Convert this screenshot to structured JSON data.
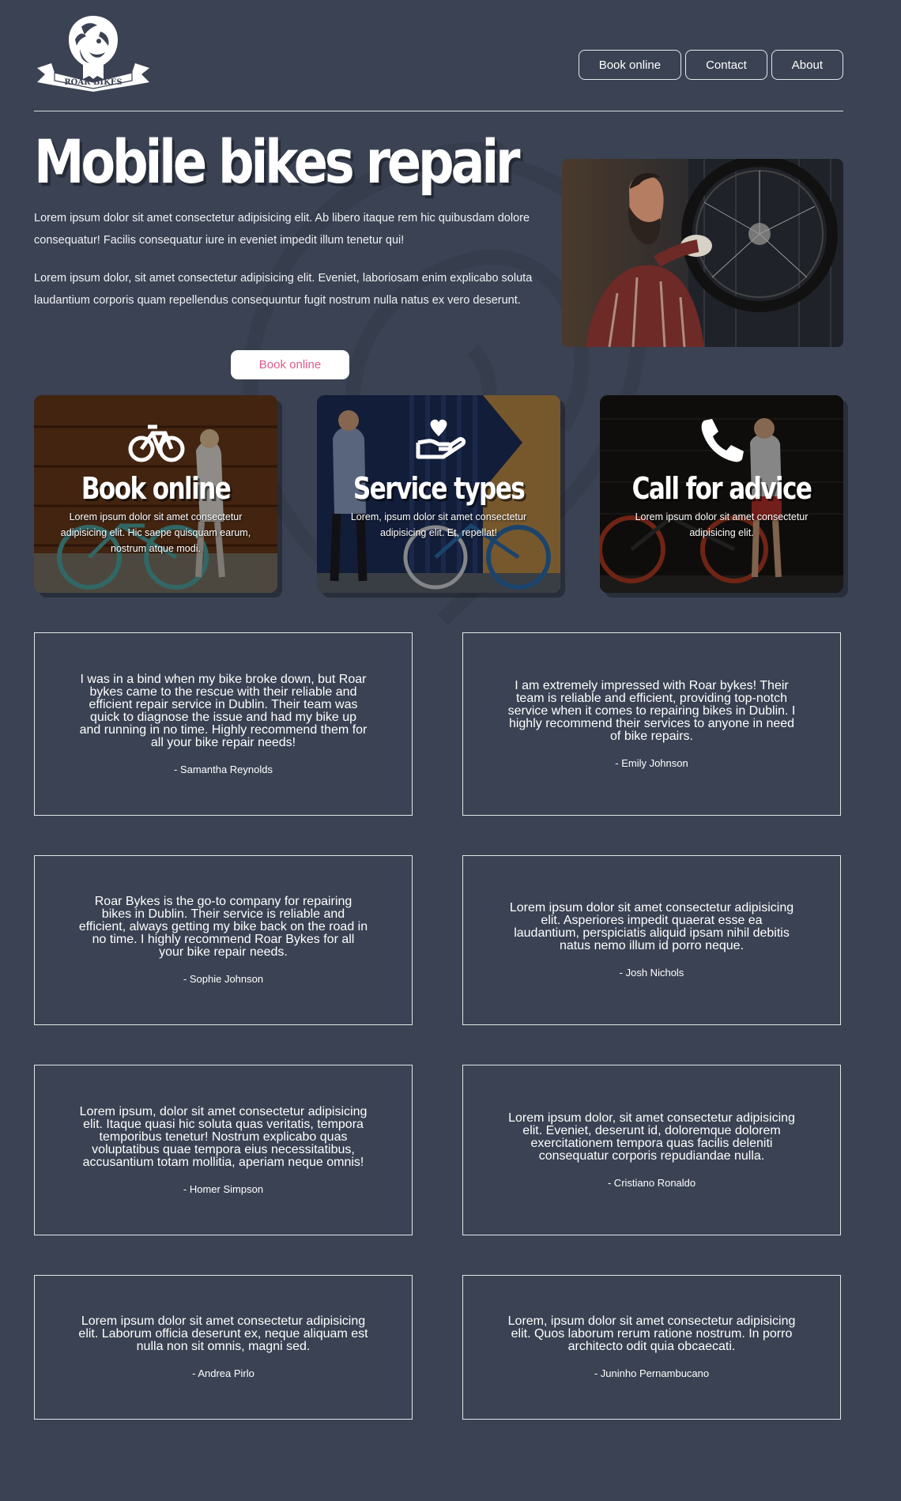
{
  "brand": {
    "logo_text": "ROAR BIKES"
  },
  "nav": [
    "Book online",
    "Contact",
    "About"
  ],
  "hero": {
    "title": "Mobile bikes repair",
    "p1": "Lorem ipsum dolor sit amet consectetur adipisicing elit. Ab libero itaque rem hic quibusdam dolore consequatur! Facilis consequatur iure in eveniet impedit illum tenetur qui!",
    "p2": "Lorem ipsum dolor, sit amet consectetur adipisicing elit. Eveniet, laboriosam enim explicabo soluta laudantium corporis quam repellendus consequuntur fugit nostrum nulla natus ex vero deserunt.",
    "cta": "Book online",
    "cta_color": "#e05a88"
  },
  "cards": [
    {
      "title": "Book online",
      "desc": "Lorem ipsum dolor sit amet consectetur adipisicing elit. Hic saepe quisquam earum, nostrum atque modi.",
      "icon": "bicycle-icon"
    },
    {
      "title": "Service types",
      "desc": "Lorem, ipsum dolor sit amet consectetur adipisicing elit. Et, repellat!",
      "icon": "hand-heart-icon"
    },
    {
      "title": "Call for advice",
      "desc": "Lorem ipsum dolor sit amet consectetur adipisicing elit.",
      "icon": "phone-icon"
    }
  ],
  "testimonials": [
    {
      "quote": "I was in a bind when my bike broke down, but Roar bykes came to the rescue with their reliable and efficient repair service in Dublin. Their team was quick to diagnose the issue and had my bike up and running in no time. Highly recommend them for all your bike repair needs!",
      "author": "- Samantha Reynolds"
    },
    {
      "quote": "I am extremely impressed with Roar bykes! Their team is reliable and efficient, providing top-notch service when it comes to repairing bikes in Dublin. I highly recommend their services to anyone in need of bike repairs.",
      "author": "- Emily Johnson"
    },
    {
      "quote": "Roar Bykes is the go-to company for repairing bikes in Dublin. Their service is reliable and efficient, always getting my bike back on the road in no time. I highly recommend Roar Bykes for all your bike repair needs.",
      "author": "- Sophie Johnson"
    },
    {
      "quote": "Lorem ipsum dolor sit amet consectetur adipisicing elit. Asperiores impedit quaerat esse ea laudantium, perspiciatis aliquid ipsam nihil debitis natus nemo illum id porro neque.",
      "author": "- Josh Nichols"
    },
    {
      "quote": "Lorem ipsum, dolor sit amet consectetur adipisicing elit. Itaque quasi hic soluta quas veritatis, tempora temporibus tenetur! Nostrum explicabo quas voluptatibus quae tempora eius necessitatibus, accusantium totam mollitia, aperiam neque omnis!",
      "author": "- Homer Simpson"
    },
    {
      "quote": "Lorem ipsum dolor, sit amet consectetur adipisicing elit. Eveniet, deserunt id, doloremque dolorem exercitationem tempora quas facilis deleniti consequatur corporis repudiandae nulla.",
      "author": "- Cristiano Ronaldo"
    },
    {
      "quote": "Lorem ipsum dolor sit amet consectetur adipisicing elit. Laborum officia deserunt ex, neque aliquam est nulla non sit omnis, magni sed.",
      "author": "- Andrea Pirlo"
    },
    {
      "quote": "Lorem, ipsum dolor sit amet consectetur adipisicing elit. Quos laborum rerum ratione nostrum. In porro architecto odit quia obcaecati.",
      "author": "- Juninho Pernambucano"
    }
  ]
}
